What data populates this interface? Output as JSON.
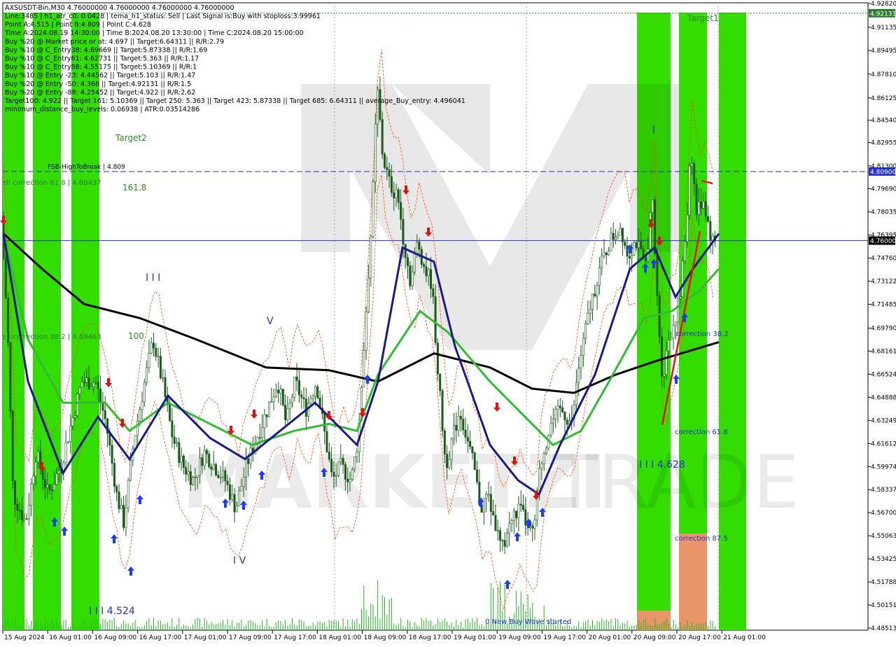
{
  "chart_data": {
    "type": "candlestick",
    "symbol_line": "AXSUSDT-Bin,M30  4.76000000 4.76000000 4.76000000 4.76000000",
    "info_lines": [
      "Line:3485 | h1_atr_c0: 0.0428 | tema_h1_status: Sell | Last Signal is:Buy with stoploss:3.99961",
      "Point A:4.515 | Point B:4.809 | Point C:4.628",
      "Time A:2024.08.19 14:30:00 | Time B:2024.08.20 13:30:00 | Time C:2024.08.20 15:00:00",
      "Buy %20 @ Market price or at: 4.697 || Target:6.64311 || R/R:2.79",
      "Buy %10 @ C_Entry38: 4.69669 || Target:5.87338 || R/R:1.69",
      "Buy %10 @ C_Entry61: 4.62731 || Target:5.363 || R/R:1.17",
      "Buy %10 @ C_Entry88: 4.55175 || Target:5.10369 || R/R:1",
      "Buy %10 @ Entry -23: 4.44562 || Target:5.103 || R/R:1.47",
      "Buy %20 @ Entry -50: 4.368 || Target:4.92131 || R/R:1.5",
      "Buy %20 @ Entry -88: 4.25452 || Target:4.922 || R/R:2.62",
      "Target100: 4.922 || Target 161: 5.10369 || Target 250: 5.363 || Target 423: 5.87338 || Target 685: 6.64311 || average_Buy_entry: 4.496041",
      "minimum_distance_buy_levels: 0.06938 | ATR:0.03514286"
    ],
    "y_ticks": [
      "4.92820",
      "4.91135",
      "4.89495",
      "4.87810",
      "4.86125",
      "4.84540",
      "4.82955",
      "4.81300",
      "4.79690",
      "4.78035",
      "4.76395",
      "4.74760",
      "4.73122",
      "4.71485",
      "4.69790",
      "4.68161",
      "4.66524",
      "4.64888",
      "4.63249",
      "4.61612",
      "4.59974",
      "4.58337",
      "4.56700",
      "4.55063",
      "4.53425",
      "4.51788",
      "4.50151",
      "4.48513"
    ],
    "y_tick_values": [
      4.9282,
      4.91135,
      4.89495,
      4.8781,
      4.86125,
      4.8454,
      4.82955,
      4.813,
      4.7969,
      4.78035,
      4.76395,
      4.7476,
      4.73122,
      4.71485,
      4.6979,
      4.68161,
      4.66524,
      4.64888,
      4.63249,
      4.61612,
      4.59974,
      4.58337,
      4.567,
      4.55063,
      4.53425,
      4.51788,
      4.50151,
      4.48513
    ],
    "x_ticks": [
      "15 Aug 2024",
      "16 Aug 01:00",
      "16 Aug 09:00",
      "16 Aug 17:00",
      "17 Aug 01:00",
      "17 Aug 09:00",
      "17 Aug 17:00",
      "18 Aug 01:00",
      "18 Aug 09:00",
      "18 Aug 17:00",
      "19 Aug 01:00",
      "19 Aug 09:00",
      "19 Aug 17:00",
      "20 Aug 01:00",
      "20 Aug 09:00",
      "20 Aug 17:00",
      "21 Aug 01:00"
    ],
    "ylim": [
      4.48513,
      4.9282
    ],
    "price_tags": [
      {
        "label": "4.92131",
        "value": 4.92131,
        "color": "#2e7d32"
      },
      {
        "label": "4.80900",
        "value": 4.809,
        "color": "#2233cc"
      },
      {
        "label": "4.76000",
        "value": 4.76,
        "color": "#000000"
      }
    ],
    "h_lines": [
      {
        "value": 4.92131,
        "color": "#2e8b2e",
        "style": "dotted"
      },
      {
        "value": 4.809,
        "color": "#2233cc",
        "style": "dashed"
      },
      {
        "value": 4.76,
        "color": "#2233cc",
        "style": "solid"
      }
    ],
    "annotations": [
      {
        "text": "FSB-HighToBreak | 4.809",
        "color": "#000000"
      },
      {
        "text": "ell correction 61.8 | 4.80437",
        "color": "#2e7d32"
      },
      {
        "text": "Target2",
        "color": "#2e8b2e"
      },
      {
        "text": "161.8",
        "color": "#2e8b2e"
      },
      {
        "text": "ell correction 38.2 | 4.69463",
        "color": "#2e7d32"
      },
      {
        "text": "100",
        "color": "#2e8b2e"
      },
      {
        "text": "I I I",
        "color": "#2233cc"
      },
      {
        "text": "V",
        "color": "#2233cc"
      },
      {
        "text": "I V",
        "color": "#2233cc"
      },
      {
        "text": "I I I 4.524",
        "color": "#2233cc"
      },
      {
        "text": "I",
        "color": "#2233cc"
      },
      {
        "text": "I I I 4.628",
        "color": "#2233cc"
      },
      {
        "text": "correction 38.2",
        "color": "#2233cc"
      },
      {
        "text": "correction 61.8",
        "color": "#2233cc"
      },
      {
        "text": "correction 87.5",
        "color": "#2233cc"
      },
      {
        "text": "Target1",
        "color": "#2e8b2e"
      },
      {
        "text": "0 New Buy Wave started",
        "color": "#2233cc"
      }
    ],
    "colors": {
      "up_candle": "#006400",
      "down_candle": "#006400",
      "green_band": "#33dd00",
      "orange_band": "#e8956a",
      "ma_black": "#000000",
      "ma_navy": "#1a1a8c",
      "ma_green": "#33bb33",
      "channel": "#ff4400",
      "buy_arrow": "#1a3cff",
      "sell_arrow": "#e01010"
    },
    "watermark": "MARKETZITRADE"
  }
}
